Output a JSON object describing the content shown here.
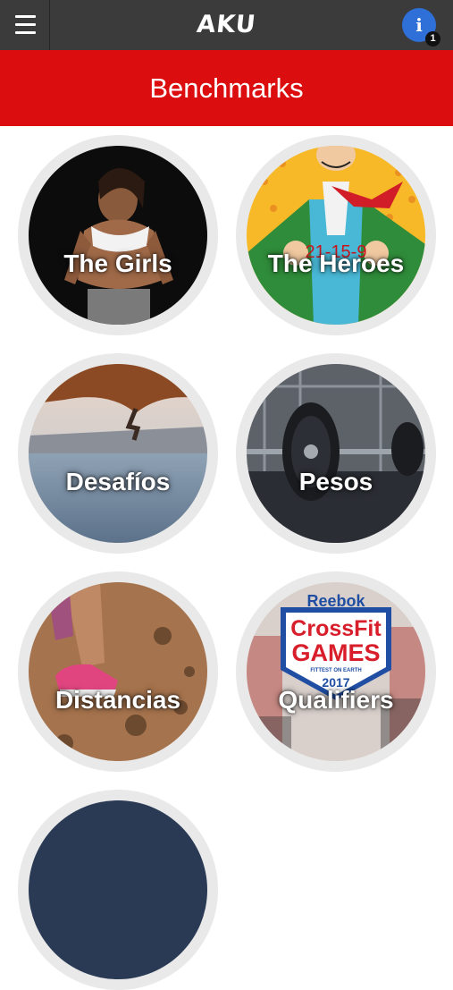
{
  "app": {
    "logo": "AKU"
  },
  "topbar": {
    "info_glyph": "i",
    "notification_count": "1"
  },
  "header": {
    "title": "Benchmarks"
  },
  "tiles": [
    {
      "label": "The Girls"
    },
    {
      "label": "The Heroes",
      "image_text": "21-15-9"
    },
    {
      "label": "Desafíos"
    },
    {
      "label": "Pesos"
    },
    {
      "label": "Distancias"
    },
    {
      "label": "Qualifiers",
      "logo_line1": "Reebok",
      "logo_line2": "CrossFit",
      "logo_line3": "GAMES",
      "logo_line4": "FITTEST ON EARTH",
      "logo_year": "2017"
    }
  ],
  "colors": {
    "topbar": "#3b3b3b",
    "header": "#dc0d0e",
    "info": "#2f6fd8",
    "ring": "#e9e9e9"
  }
}
